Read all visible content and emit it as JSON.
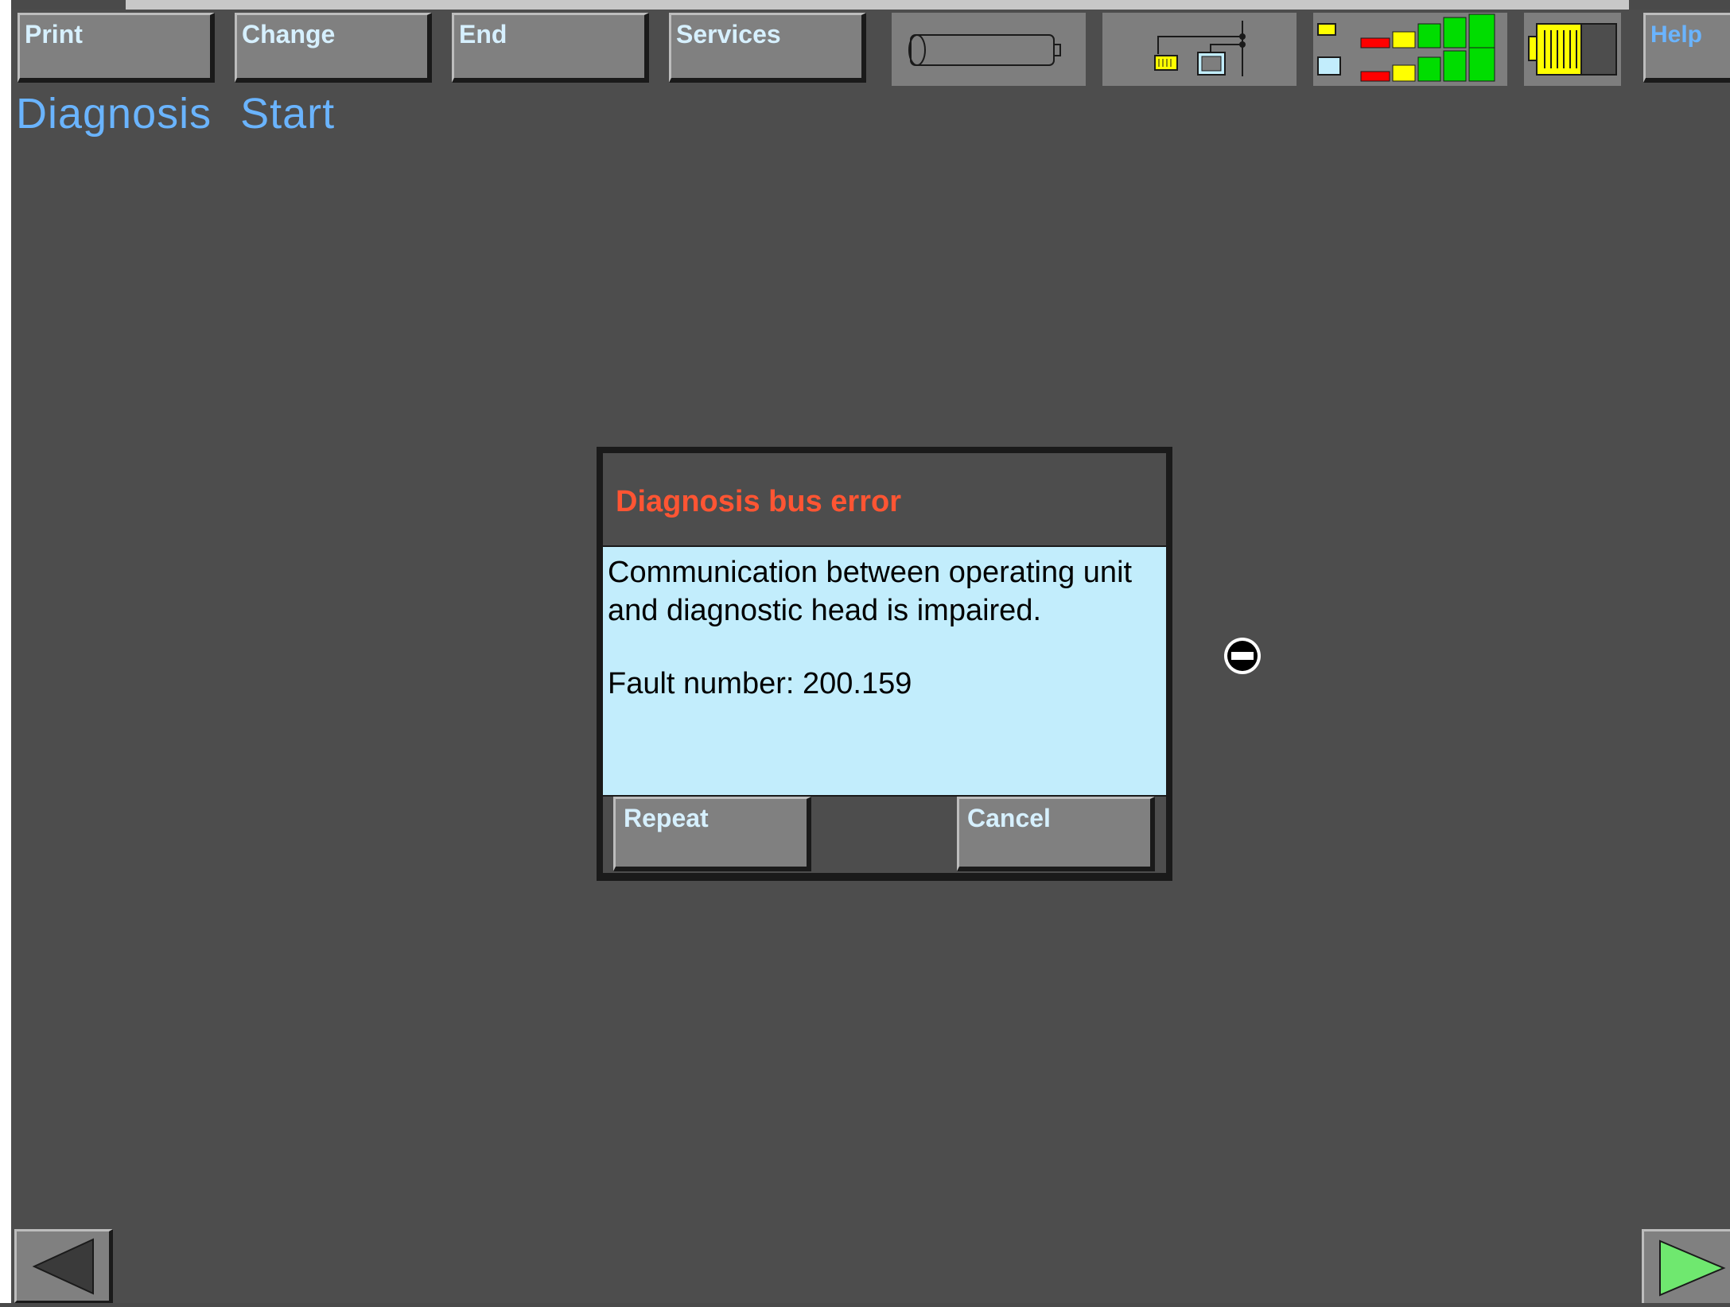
{
  "toolbar": {
    "print_label": "Print",
    "change_label": "Change",
    "end_label": "End",
    "services_label": "Services",
    "help_label": "Help",
    "status_icons": [
      "cylinder-gauge-icon",
      "connection-diagram-icon",
      "signal-level-icon",
      "battery-icon"
    ]
  },
  "header": {
    "title_part1": "Diagnosis",
    "title_part2": "Start"
  },
  "dialog": {
    "title": "Diagnosis bus error",
    "message_line1": "Communication between operating unit",
    "message_line2": "and diagnostic head is impaired.",
    "fault": "Fault number: 200.159",
    "repeat_label": "Repeat",
    "cancel_label": "Cancel"
  },
  "colors": {
    "background": "#4d4d4d",
    "accent_text": "#6ab4ff",
    "error_title": "#ff5533",
    "dialog_body": "#c2edfc"
  }
}
